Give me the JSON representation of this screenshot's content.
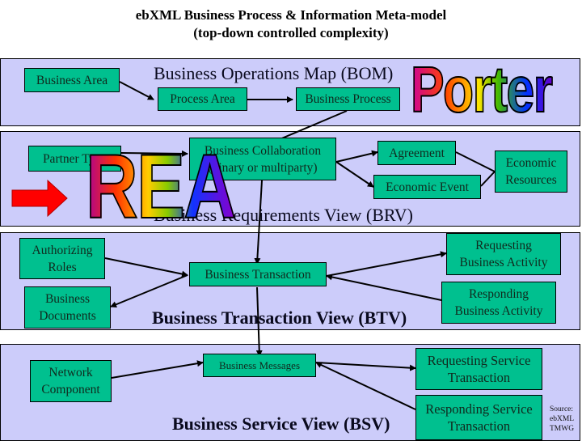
{
  "title": {
    "line1": "ebXML Business Process & Information Meta-model",
    "line2": "(top-down controlled complexity)"
  },
  "colors": {
    "band_fill": "#ccccfa",
    "box_fill": "#00c08f",
    "arrow": "#000000",
    "red_arrow": "#ff0000"
  },
  "bom": {
    "label": "Business Operations Map (BOM)",
    "business_area": "Business Area",
    "process_area": "Process Area",
    "business_process": "Business Process"
  },
  "brv": {
    "label": "Business Requirements View (BRV)",
    "partner_type": "Partner Type",
    "collab_line1": "Business Collaboration",
    "collab_line2": "(binary or multiparty)",
    "agreement": "Agreement",
    "economic_event": "Economic Event",
    "econ_res_line1": "Economic",
    "econ_res_line2": "Resources"
  },
  "btv": {
    "label": "Business Transaction View (BTV)",
    "auth_line1": "Authorizing",
    "auth_line2": "Roles",
    "docs_line1": "Business",
    "docs_line2": "Documents",
    "business_transaction": "Business Transaction",
    "req_line1": "Requesting",
    "req_line2": "Business Activity",
    "resp_line1": "Responding",
    "resp_line2": "Business Activity"
  },
  "bsv": {
    "label": "Business Service View (BSV)",
    "net_line1": "Network",
    "net_line2": "Component",
    "business_messages": "Business Messages",
    "req_line1": "Requesting Service",
    "req_line2": "Transaction",
    "resp_line1": "Responding Service",
    "resp_line2": "Transaction"
  },
  "overlays": {
    "porter": "Porter",
    "rea": "REA"
  },
  "source": {
    "line1": "Source:",
    "line2": "ebXML",
    "line3": "TMWG"
  }
}
